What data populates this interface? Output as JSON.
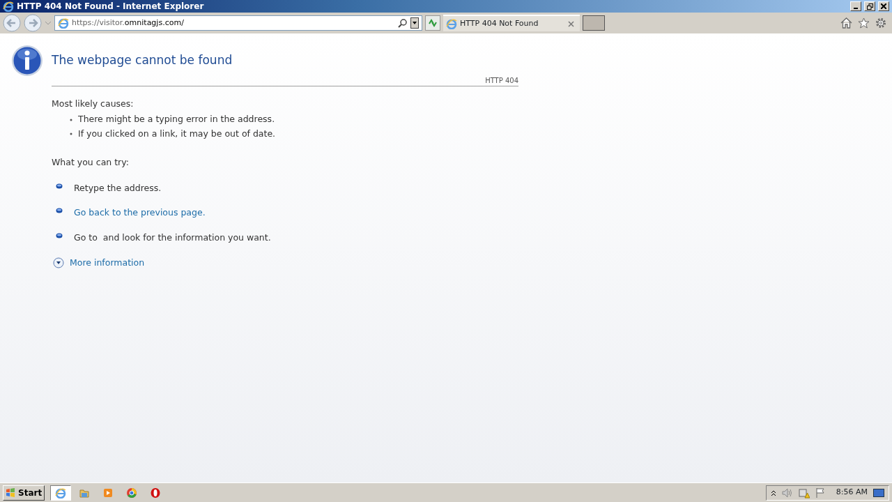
{
  "window": {
    "title": "HTTP 404 Not Found - Internet Explorer"
  },
  "address_bar": {
    "url_prefix": "https://visitor.",
    "url_host": "omnitagjs.com/"
  },
  "tabs": [
    {
      "label": "HTTP 404 Not Found",
      "selected": true
    }
  ],
  "page": {
    "heading": "The webpage cannot be found",
    "code": "HTTP 404",
    "causes_title": "Most likely causes:",
    "causes": [
      "There might be a typing error in the address.",
      "If you clicked on a link, it may be out of date."
    ],
    "try_title": "What you can try:",
    "tries": [
      {
        "kind": "text",
        "text": "Retype the address."
      },
      {
        "kind": "link",
        "text": "Go back to the previous page."
      },
      {
        "kind": "text",
        "text": "Go to  and look for the information you want."
      }
    ],
    "more": {
      "label": "More information",
      "expanded": false
    }
  },
  "taskbar": {
    "start": "Start",
    "apps": [
      {
        "kind": "ie",
        "selected": true
      },
      {
        "kind": "folder",
        "selected": false
      },
      {
        "kind": "media",
        "selected": false
      },
      {
        "kind": "chrome",
        "selected": false
      },
      {
        "kind": "opera",
        "selected": false
      }
    ],
    "clock": "8:56 AM"
  }
}
